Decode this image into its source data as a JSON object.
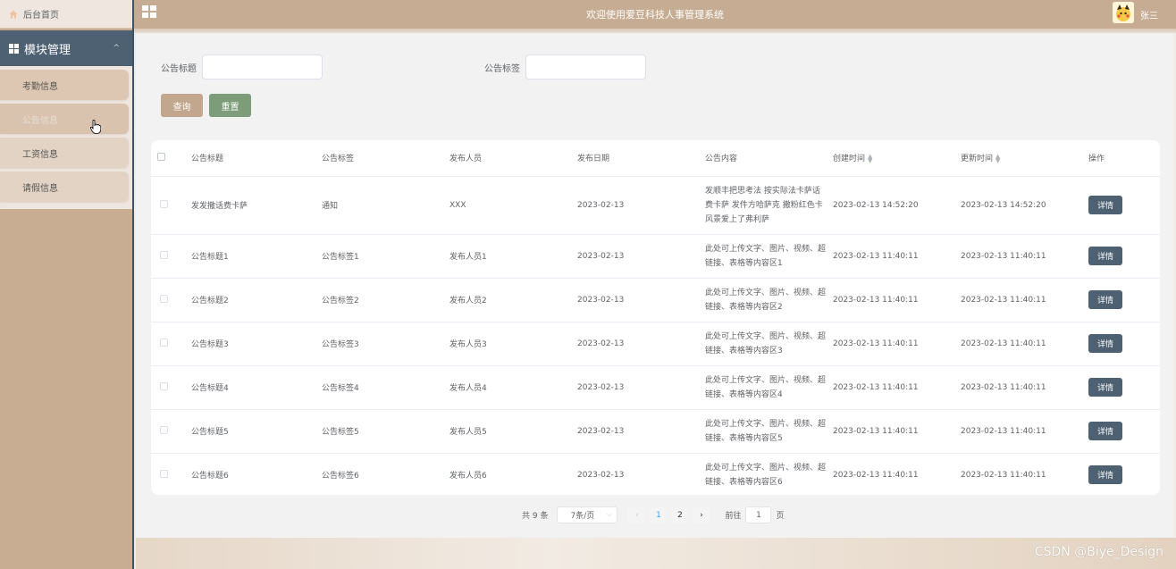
{
  "app": {
    "title": "欢迎使用爱豆科技人事管理系统",
    "user": "张三"
  },
  "sidebar": {
    "home": "后台首页",
    "group": "模块管理",
    "items": [
      {
        "label": "考勤信息"
      },
      {
        "label": "公告信息"
      },
      {
        "label": "工资信息"
      },
      {
        "label": "请假信息"
      }
    ]
  },
  "search": {
    "title_label": "公告标题",
    "tag_label": "公告标签",
    "query_btn": "查询",
    "reset_btn": "重置"
  },
  "table": {
    "headers": [
      "公告标题",
      "公告标签",
      "发布人员",
      "发布日期",
      "公告内容",
      "创建时间",
      "更新时间",
      "操作"
    ],
    "detail_btn": "详情",
    "rows": [
      {
        "title": "发发撒话费卡萨",
        "tag": "通知",
        "author": "XXX",
        "date": "2023-02-13",
        "content": "发顺丰把思考法 按实际法卡萨话费卡萨 发件方哈萨克 撒粉红色卡 风景爱上了弗利萨",
        "created": "2023-02-13 14:52:20",
        "updated": "2023-02-13 14:52:20"
      },
      {
        "title": "公告标题1",
        "tag": "公告标签1",
        "author": "发布人员1",
        "date": "2023-02-13",
        "content": "此处可上传文字、图片、视频、超链接、表格等内容区1",
        "created": "2023-02-13 11:40:11",
        "updated": "2023-02-13 11:40:11"
      },
      {
        "title": "公告标题2",
        "tag": "公告标签2",
        "author": "发布人员2",
        "date": "2023-02-13",
        "content": "此处可上传文字、图片、视频、超链接、表格等内容区2",
        "created": "2023-02-13 11:40:11",
        "updated": "2023-02-13 11:40:11"
      },
      {
        "title": "公告标题3",
        "tag": "公告标签3",
        "author": "发布人员3",
        "date": "2023-02-13",
        "content": "此处可上传文字、图片、视频、超链接、表格等内容区3",
        "created": "2023-02-13 11:40:11",
        "updated": "2023-02-13 11:40:11"
      },
      {
        "title": "公告标题4",
        "tag": "公告标签4",
        "author": "发布人员4",
        "date": "2023-02-13",
        "content": "此处可上传文字、图片、视频、超链接、表格等内容区4",
        "created": "2023-02-13 11:40:11",
        "updated": "2023-02-13 11:40:11"
      },
      {
        "title": "公告标题5",
        "tag": "公告标签5",
        "author": "发布人员5",
        "date": "2023-02-13",
        "content": "此处可上传文字、图片、视频、超链接、表格等内容区5",
        "created": "2023-02-13 11:40:11",
        "updated": "2023-02-13 11:40:11"
      },
      {
        "title": "公告标题6",
        "tag": "公告标签6",
        "author": "发布人员6",
        "date": "2023-02-13",
        "content": "此处可上传文字、图片、视频、超链接、表格等内容区6",
        "created": "2023-02-13 11:40:11",
        "updated": "2023-02-13 11:40:11"
      }
    ]
  },
  "pagination": {
    "total": "共 9 条",
    "page_size": "7条/页",
    "prev": "‹",
    "pages": [
      "1",
      "2"
    ],
    "current": "1",
    "next": "›",
    "goto_label": "前往",
    "goto_value": "1",
    "page_unit": "页"
  },
  "watermark": "CSDN @Biye_Design",
  "icons": {
    "home": "home-icon",
    "grid": "grid-icon",
    "menu": "menu-grid-icon",
    "chevron": "chevron-up-icon",
    "sort": "sort-icon",
    "cursor": "hand-cursor-icon",
    "avatar": "user-avatar"
  },
  "colors": {
    "header": "#c6ac92",
    "sidebar": "#c9ad93",
    "group": "#4d6173",
    "query": "#c2a78e",
    "reset": "#7d9c7a",
    "detail": "#4d6173",
    "page_active": "#409eff"
  }
}
